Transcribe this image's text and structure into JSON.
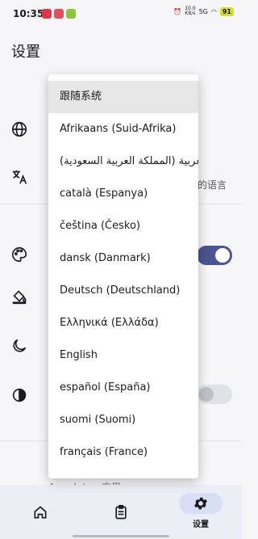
{
  "status_bar": {
    "time": "10:35",
    "speed_top": "10.0",
    "speed_bottom": "KB/s",
    "network": "5G",
    "battery": "91"
  },
  "page": {
    "title": "设置"
  },
  "background": {
    "partial_language_text": "的语言",
    "app_date_partial": "App date : 应用",
    "toggle_theme_on": true,
    "toggle_dark_on": false
  },
  "language_menu": {
    "selected_index": 0,
    "items": [
      "跟随系统",
      "Afrikaans (Suid-Afrika)",
      "العربية (المملكة العربية السعودية)",
      "català (Espanya)",
      "čeština (Česko)",
      "dansk (Danmark)",
      "Deutsch (Deutschland)",
      "Ελληνικά (Ελλάδα)",
      "English",
      "español (España)",
      "suomi (Suomi)",
      "français (France)"
    ]
  },
  "bottom_nav": {
    "settings_label": "设置"
  },
  "colors": {
    "accent": "#4a5591",
    "nav_bg": "#eceef5",
    "selected_nav_pill": "#d8def3"
  }
}
